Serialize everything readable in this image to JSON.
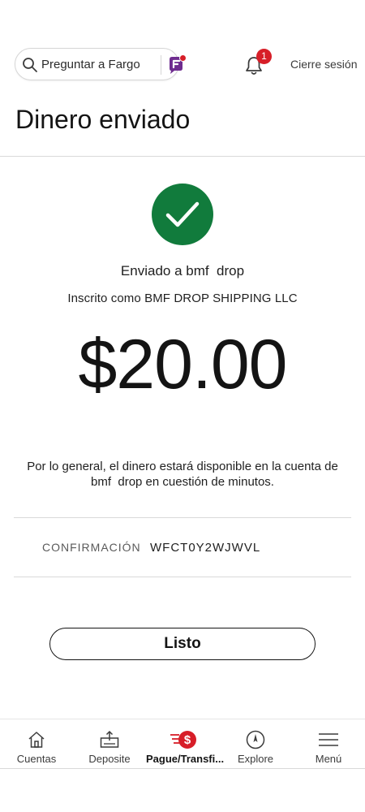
{
  "header": {
    "search_label": "Preguntar a Fargo",
    "notification_count": "1",
    "signout_label": "Cierre sesión"
  },
  "page": {
    "title": "Dinero enviado"
  },
  "result": {
    "sent_to": "Enviado a bmf  drop",
    "enrolled_as": "Inscrito como BMF DROP SHIPPING LLC",
    "amount": "$20.00",
    "notice": "Por lo general, el dinero estará disponible en la cuenta de bmf  drop en cuestión de minutos.",
    "confirmation_label": "CONFIRMACIÓN",
    "confirmation_value": "WFCT0Y2WJWVL",
    "done_label": "Listo"
  },
  "nav": {
    "items": [
      {
        "label": "Cuentas",
        "icon": "home-icon"
      },
      {
        "label": "Deposite",
        "icon": "deposit-icon"
      },
      {
        "label": "Pague/Transfi...",
        "icon": "pay-transfer-icon",
        "active": true
      },
      {
        "label": "Explore",
        "icon": "compass-icon"
      },
      {
        "label": "Menú",
        "icon": "menu-icon"
      }
    ]
  },
  "colors": {
    "success_green": "#117b3c",
    "badge_red": "#d71e28",
    "fargo_purple": "#6e2c8f"
  }
}
